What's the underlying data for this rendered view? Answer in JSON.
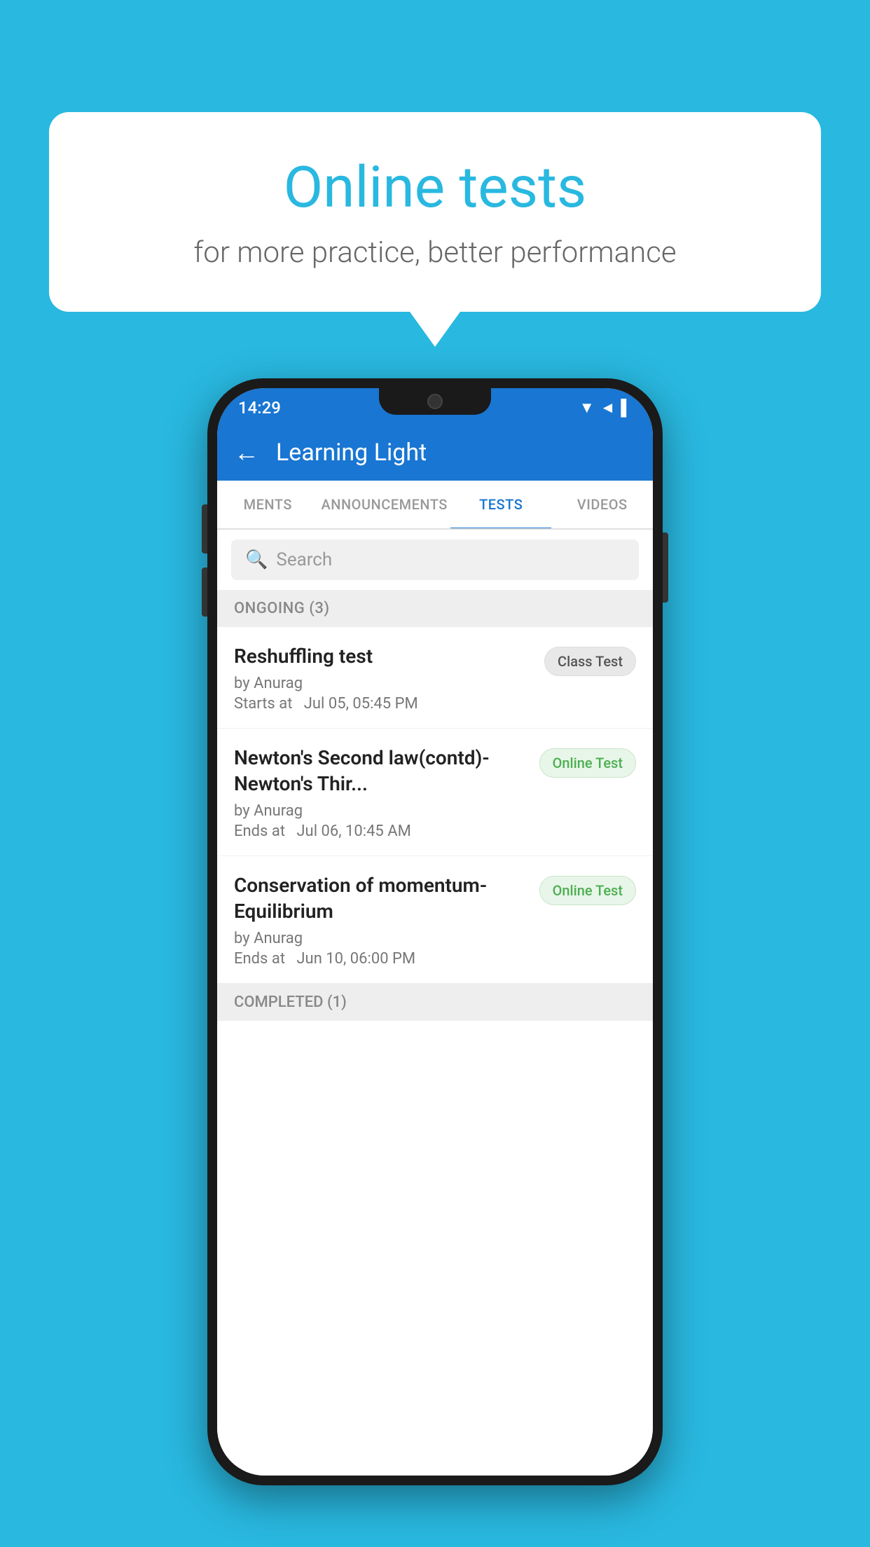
{
  "background_color": "#29b8e0",
  "speech_bubble": {
    "title": "Online tests",
    "subtitle": "for more practice, better performance"
  },
  "phone": {
    "status_bar": {
      "time": "14:29",
      "signal_icons": "▼◄▌"
    },
    "app_bar": {
      "title": "Learning Light",
      "back_label": "←"
    },
    "tabs": [
      {
        "label": "MENTS",
        "active": false
      },
      {
        "label": "ANNOUNCEMENTS",
        "active": false
      },
      {
        "label": "TESTS",
        "active": true
      },
      {
        "label": "VIDEOS",
        "active": false
      }
    ],
    "search": {
      "placeholder": "Search",
      "icon": "🔍"
    },
    "ongoing_section": {
      "header": "ONGOING (3)",
      "tests": [
        {
          "name": "Reshuffling test",
          "by": "by Anurag",
          "time_label": "Starts at",
          "time_value": "Jul 05, 05:45 PM",
          "badge_text": "Class Test",
          "badge_type": "class"
        },
        {
          "name": "Newton's Second law(contd)-Newton's Thir...",
          "by": "by Anurag",
          "time_label": "Ends at",
          "time_value": "Jul 06, 10:45 AM",
          "badge_text": "Online Test",
          "badge_type": "online"
        },
        {
          "name": "Conservation of momentum-Equilibrium",
          "by": "by Anurag",
          "time_label": "Ends at",
          "time_value": "Jun 10, 06:00 PM",
          "badge_text": "Online Test",
          "badge_type": "online"
        }
      ]
    },
    "completed_section": {
      "header": "COMPLETED (1)"
    }
  }
}
